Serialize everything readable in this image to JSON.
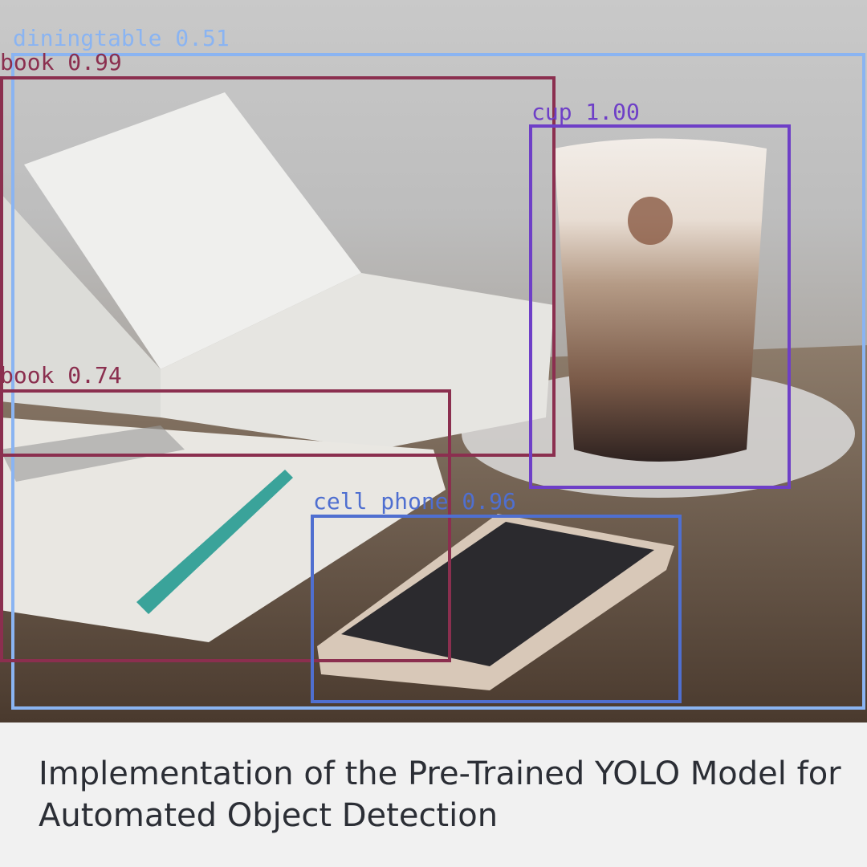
{
  "detections": [
    {
      "label": "diningtable 0.51",
      "color": "#8ab4f2"
    },
    {
      "label": "book 0.99",
      "color": "#8b2f4f"
    },
    {
      "label": "cup 1.00",
      "color": "#6e3fc7"
    },
    {
      "label": "book 0.74",
      "color": "#8b2f4f"
    },
    {
      "label": "cell phone 0.96",
      "color": "#4f6fd0"
    }
  ],
  "caption": {
    "text": "Implementation of the Pre-Trained YOLO Model for Automated Object Detection"
  }
}
